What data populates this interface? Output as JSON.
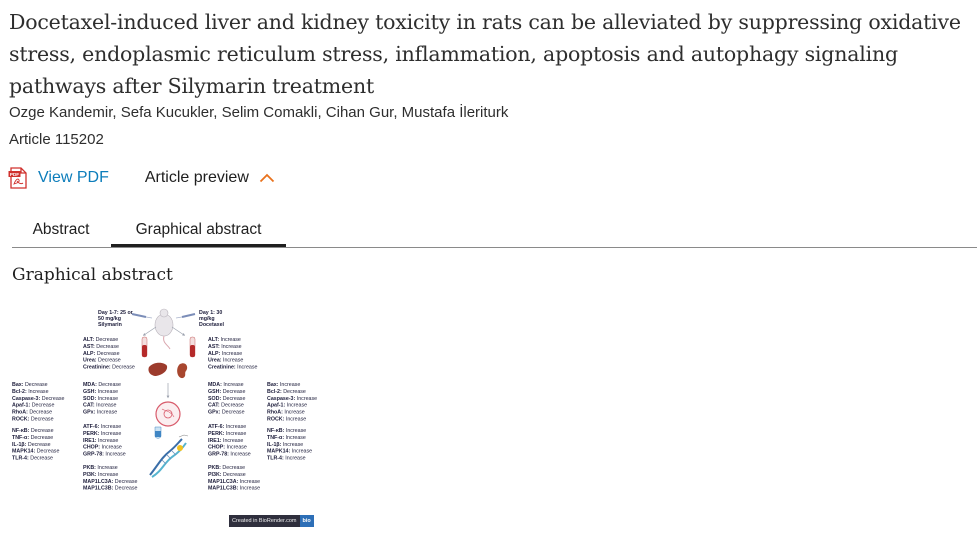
{
  "article": {
    "title": "Docetaxel-induced liver and kidney toxicity in rats can be alleviated by suppressing oxidative stress, endoplasmic reticulum stress, inflammation, apoptosis and autophagy signaling pathways after Silymarin treatment",
    "authors": "Ozge Kandemir, Sefa Kucukler, Selim Comakli, Cihan Gur, Mustafa İleriturk",
    "article_number": "Article 115202"
  },
  "actions": {
    "view_pdf": "View PDF",
    "article_preview": "Article preview"
  },
  "tabs": [
    {
      "label": "Abstract",
      "active": false
    },
    {
      "label": "Graphical abstract",
      "active": true
    }
  ],
  "section": {
    "heading": "Graphical abstract"
  },
  "graphical_abstract": {
    "left_dose": [
      "Day 1-7: 25 or",
      "50 mg/kg",
      "Silymarin"
    ],
    "right_dose": [
      "Day 1: 30",
      "mg/kg",
      "Docetaxel"
    ],
    "left_serum": [
      {
        "k": "ALT:",
        "v": "Decrease"
      },
      {
        "k": "AST:",
        "v": "Decrease"
      },
      {
        "k": "ALP:",
        "v": "Decrease"
      },
      {
        "k": "Urea:",
        "v": "Decrease"
      },
      {
        "k": "Creatinine:",
        "v": "Decrease"
      }
    ],
    "right_serum": [
      {
        "k": "ALT:",
        "v": "Increase"
      },
      {
        "k": "AST:",
        "v": "Increase"
      },
      {
        "k": "ALP:",
        "v": "Increase"
      },
      {
        "k": "Urea:",
        "v": "Increase"
      },
      {
        "k": "Creatinine:",
        "v": "Increase"
      }
    ],
    "far_left_apoptosis": [
      {
        "k": "Bax:",
        "v": "Decrease"
      },
      {
        "k": "Bcl-2:",
        "v": "Increase"
      },
      {
        "k": "Caspase-3:",
        "v": "Decrease"
      },
      {
        "k": "Apaf-1:",
        "v": "Decrease"
      },
      {
        "k": "RhoA:",
        "v": "Decrease"
      },
      {
        "k": "ROCK:",
        "v": "Decrease"
      }
    ],
    "far_left_inflammation": [
      {
        "k": "NF-κB:",
        "v": "Decrease"
      },
      {
        "k": "TNF-α:",
        "v": "Decrease"
      },
      {
        "k": "IL-1β:",
        "v": "Decrease"
      },
      {
        "k": "MAPK14:",
        "v": "Decrease"
      },
      {
        "k": "TLR-4:",
        "v": "Decrease"
      }
    ],
    "left_oxidative": [
      {
        "k": "MDA:",
        "v": "Decrease"
      },
      {
        "k": "GSH:",
        "v": "Increase"
      },
      {
        "k": "SOD:",
        "v": "Increase"
      },
      {
        "k": "CAT:",
        "v": "Increase"
      },
      {
        "k": "GPx:",
        "v": "Increase"
      }
    ],
    "left_er": [
      {
        "k": "ATF-6:",
        "v": "Increase"
      },
      {
        "k": "PERK:",
        "v": "Increase"
      },
      {
        "k": "IRE1:",
        "v": "Increase"
      },
      {
        "k": "CHOP:",
        "v": "Increase"
      },
      {
        "k": "GRP-78:",
        "v": "Increase"
      }
    ],
    "left_autophagy": [
      {
        "k": "PKB:",
        "v": "Increase"
      },
      {
        "k": "PI3K:",
        "v": "Increase"
      },
      {
        "k": "MAP1LC3A:",
        "v": "Decrease"
      },
      {
        "k": "MAP1LC3B:",
        "v": "Decrease"
      }
    ],
    "right_oxidative": [
      {
        "k": "MDA:",
        "v": "Increase"
      },
      {
        "k": "GSH:",
        "v": "Decrease"
      },
      {
        "k": "SOD:",
        "v": "Decrease"
      },
      {
        "k": "CAT:",
        "v": "Decrease"
      },
      {
        "k": "GPx:",
        "v": "Decrease"
      }
    ],
    "right_er": [
      {
        "k": "ATF-6:",
        "v": "Increase"
      },
      {
        "k": "PERK:",
        "v": "Increase"
      },
      {
        "k": "IRE1:",
        "v": "Increase"
      },
      {
        "k": "CHOP:",
        "v": "Increase"
      },
      {
        "k": "GRP-78:",
        "v": "Increase"
      }
    ],
    "right_autophagy": [
      {
        "k": "PKB:",
        "v": "Decrease"
      },
      {
        "k": "PI3K:",
        "v": "Decrease"
      },
      {
        "k": "MAP1LC3A:",
        "v": "Increase"
      },
      {
        "k": "MAP1LC3B:",
        "v": "Increase"
      }
    ],
    "far_right_apoptosis": [
      {
        "k": "Bax:",
        "v": "Increase"
      },
      {
        "k": "Bcl-2:",
        "v": "Decrease"
      },
      {
        "k": "Caspase-3:",
        "v": "Increase"
      },
      {
        "k": "Apaf-1:",
        "v": "Increase"
      },
      {
        "k": "RhoA:",
        "v": "Increase"
      },
      {
        "k": "ROCK:",
        "v": "Increase"
      }
    ],
    "far_right_inflammation": [
      {
        "k": "NF-κB:",
        "v": "Increase"
      },
      {
        "k": "TNF-α:",
        "v": "Increase"
      },
      {
        "k": "IL-1β:",
        "v": "Increase"
      },
      {
        "k": "MAPK14:",
        "v": "Increase"
      },
      {
        "k": "TLR-4:",
        "v": "Increase"
      }
    ],
    "credit_left": "Created in BioRender.com",
    "credit_right": "bio"
  },
  "colors": {
    "link": "#0c7dbb",
    "pdf_red": "#d0312d",
    "accent_orange": "#e9711c"
  }
}
